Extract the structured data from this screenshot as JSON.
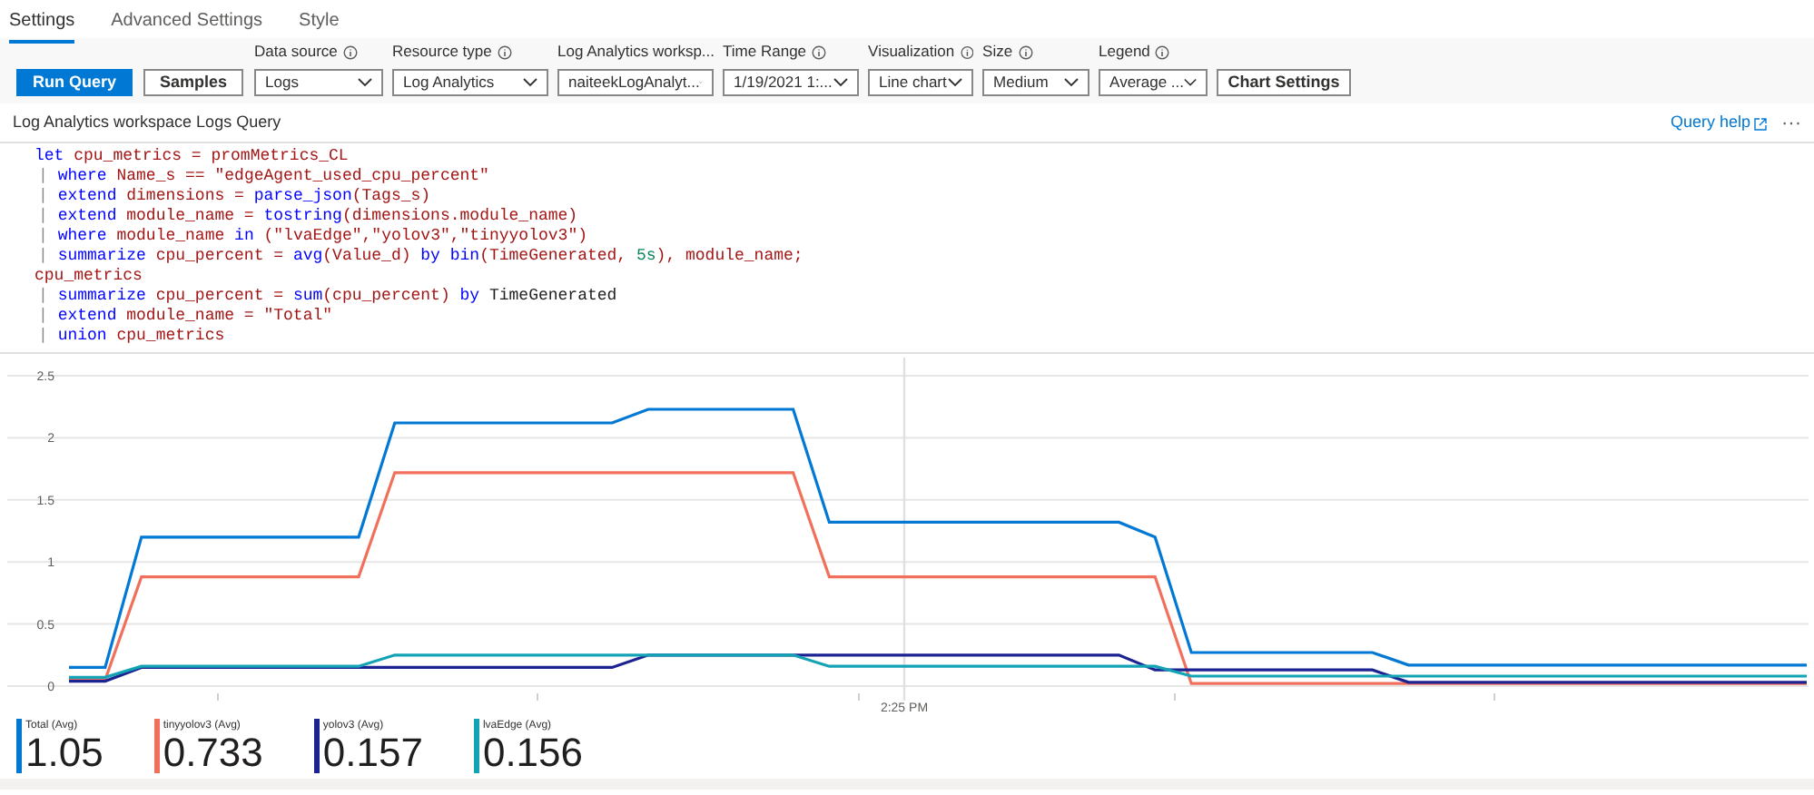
{
  "tabs": [
    {
      "label": "Settings",
      "selected": true
    },
    {
      "label": "Advanced Settings",
      "selected": false
    },
    {
      "label": "Style",
      "selected": false
    }
  ],
  "toolbar": {
    "buttons": [
      {
        "label": "Run Query",
        "kind": "primary"
      },
      {
        "label": "Samples",
        "kind": "secondary"
      }
    ],
    "fields": [
      {
        "label": "Data source",
        "value": "Logs"
      },
      {
        "label": "Resource type",
        "value": "Log Analytics"
      },
      {
        "label": "Log Analytics worksp...",
        "value": "naiteekLogAnalyt..."
      },
      {
        "label": "Time Range",
        "value": "1/19/2021 1:..."
      },
      {
        "label": "Visualization",
        "value": "Line chart"
      },
      {
        "label": "Size",
        "value": "Medium"
      },
      {
        "label": "Legend",
        "value": "Average ..."
      }
    ],
    "chart_settings_button": "Chart Settings"
  },
  "query": {
    "title": "Log Analytics workspace Logs Query",
    "help_link": "Query help",
    "more": "···",
    "lines": [
      [
        {
          "text": "let",
          "kind": "keyword"
        },
        {
          "text": " cpu_metrics = promMetrics_CL",
          "kind": "name"
        }
      ],
      [
        {
          "text": "| ",
          "kind": "pipe"
        },
        {
          "text": "where",
          "kind": "keyword"
        },
        {
          "text": " Name_s == \"edgeAgent_used_cpu_percent\"",
          "kind": "name"
        }
      ],
      [
        {
          "text": "| ",
          "kind": "pipe"
        },
        {
          "text": "extend",
          "kind": "keyword"
        },
        {
          "text": " dimensions = ",
          "kind": "name"
        },
        {
          "text": "parse_json",
          "kind": "keyword"
        },
        {
          "text": "(Tags_s)",
          "kind": "name"
        }
      ],
      [
        {
          "text": "| ",
          "kind": "pipe"
        },
        {
          "text": "extend",
          "kind": "keyword"
        },
        {
          "text": " module_name = ",
          "kind": "name"
        },
        {
          "text": "tostring",
          "kind": "keyword"
        },
        {
          "text": "(dimensions.module_name)",
          "kind": "name"
        }
      ],
      [
        {
          "text": "| ",
          "kind": "pipe"
        },
        {
          "text": "where",
          "kind": "keyword"
        },
        {
          "text": " module_name ",
          "kind": "name"
        },
        {
          "text": "in",
          "kind": "keyword"
        },
        {
          "text": " (\"lvaEdge\",\"yolov3\",\"tinyyolov3\")",
          "kind": "name"
        }
      ],
      [
        {
          "text": "| ",
          "kind": "pipe"
        },
        {
          "text": "summarize",
          "kind": "keyword"
        },
        {
          "text": " cpu_percent = ",
          "kind": "name"
        },
        {
          "text": "avg",
          "kind": "keyword"
        },
        {
          "text": "(Value_d) ",
          "kind": "name"
        },
        {
          "text": "by bin",
          "kind": "keyword"
        },
        {
          "text": "(TimeGenerated, ",
          "kind": "name"
        },
        {
          "text": "5s",
          "kind": "number"
        },
        {
          "text": "), module_name;",
          "kind": "name"
        }
      ],
      [
        {
          "text": "cpu_metrics",
          "kind": "name"
        }
      ],
      [
        {
          "text": "| ",
          "kind": "pipe"
        },
        {
          "text": "summarize",
          "kind": "keyword"
        },
        {
          "text": " cpu_percent = ",
          "kind": "name"
        },
        {
          "text": "sum",
          "kind": "keyword"
        },
        {
          "text": "(cpu_percent) ",
          "kind": "name"
        },
        {
          "text": "by",
          "kind": "keyword"
        },
        {
          "text": " TimeGenerated",
          "kind": "plain"
        }
      ],
      [
        {
          "text": "| ",
          "kind": "pipe"
        },
        {
          "text": "extend",
          "kind": "keyword"
        },
        {
          "text": " module_name = \"Total\"",
          "kind": "name"
        }
      ],
      [
        {
          "text": "| ",
          "kind": "pipe"
        },
        {
          "text": "union",
          "kind": "keyword"
        },
        {
          "text": " cpu_metrics",
          "kind": "name"
        }
      ]
    ]
  },
  "chart": {
    "chart_data": {
      "type": "line",
      "grid": true,
      "ylim": [
        0,
        2.5
      ],
      "yticks": [
        0,
        0.5,
        1,
        1.5,
        2,
        2.5
      ],
      "annotations": [
        {
          "text": "2:25 PM"
        }
      ],
      "series": [
        {
          "color": "#0078d4",
          "values": [
            0.15,
            0.15,
            1.2,
            1.2,
            1.2,
            1.2,
            1.2,
            1.2,
            1.2,
            2.12,
            2.12,
            2.12,
            2.12,
            2.12,
            2.12,
            2.12,
            2.23,
            2.23,
            2.23,
            2.23,
            2.23,
            1.32,
            1.32,
            1.32,
            1.32,
            1.32,
            1.32,
            1.32,
            1.32,
            1.32,
            1.2,
            0.27,
            0.27,
            0.27,
            0.27,
            0.27,
            0.27,
            0.17,
            0.17,
            0.17,
            0.17,
            0.17,
            0.17,
            0.17,
            0.17,
            0.17,
            0.17,
            0.17,
            0.17
          ]
        },
        {
          "color": "#f1705b",
          "values": [
            0.05,
            0.05,
            0.88,
            0.88,
            0.88,
            0.88,
            0.88,
            0.88,
            0.88,
            1.72,
            1.72,
            1.72,
            1.72,
            1.72,
            1.72,
            1.72,
            1.72,
            1.72,
            1.72,
            1.72,
            1.72,
            0.88,
            0.88,
            0.88,
            0.88,
            0.88,
            0.88,
            0.88,
            0.88,
            0.88,
            0.88,
            0.02,
            0.02,
            0.02,
            0.02,
            0.02,
            0.02,
            0.02,
            0.02,
            0.02,
            0.02,
            0.02,
            0.02,
            0.02,
            0.02,
            0.02,
            0.02,
            0.02,
            0.02
          ]
        },
        {
          "color": "#1b2291",
          "values": [
            0.04,
            0.04,
            0.15,
            0.15,
            0.15,
            0.15,
            0.15,
            0.15,
            0.15,
            0.15,
            0.15,
            0.15,
            0.15,
            0.15,
            0.15,
            0.15,
            0.25,
            0.25,
            0.25,
            0.25,
            0.25,
            0.25,
            0.25,
            0.25,
            0.25,
            0.25,
            0.25,
            0.25,
            0.25,
            0.25,
            0.13,
            0.13,
            0.13,
            0.13,
            0.13,
            0.13,
            0.13,
            0.03,
            0.03,
            0.03,
            0.03,
            0.03,
            0.03,
            0.03,
            0.03,
            0.03,
            0.03,
            0.03,
            0.03
          ]
        },
        {
          "color": "#13a3b5",
          "values": [
            0.07,
            0.07,
            0.16,
            0.16,
            0.16,
            0.16,
            0.16,
            0.16,
            0.16,
            0.25,
            0.25,
            0.25,
            0.25,
            0.25,
            0.25,
            0.25,
            0.25,
            0.25,
            0.25,
            0.25,
            0.25,
            0.16,
            0.16,
            0.16,
            0.16,
            0.16,
            0.16,
            0.16,
            0.16,
            0.16,
            0.16,
            0.08,
            0.08,
            0.08,
            0.08,
            0.08,
            0.08,
            0.08,
            0.08,
            0.08,
            0.08,
            0.08,
            0.08,
            0.08,
            0.08,
            0.08,
            0.08,
            0.08,
            0.08
          ]
        }
      ]
    }
  },
  "legend": [
    {
      "label": "Total (Avg)",
      "value": "1.05",
      "color": "#0078d4"
    },
    {
      "label": "tinyyolov3 (Avg)",
      "value": "0.733",
      "color": "#f1705b"
    },
    {
      "label": "yolov3 (Avg)",
      "value": "0.157",
      "color": "#1b2291"
    },
    {
      "label": "lvaEdge (Avg)",
      "value": "0.156",
      "color": "#13a3b5"
    }
  ]
}
